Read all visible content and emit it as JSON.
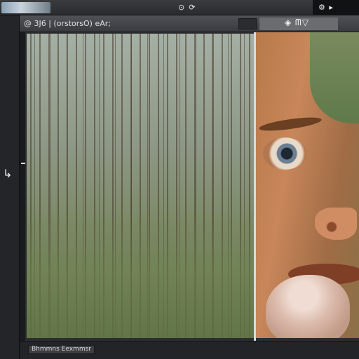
{
  "topbar": {
    "center_icons": [
      "⊙",
      "⟳"
    ],
    "right_label": "⚙ ▸"
  },
  "document": {
    "title": "@ 3J6 | (orstorsO) eAr;",
    "right_label": "◈ ᗰ▽"
  },
  "sidebar": {
    "arrow_glyph": "↳"
  },
  "statusbar": {
    "text": "Bhmmns  Eexmmsr"
  },
  "icons": {
    "topbar": [
      "view-icon",
      "rotate-icon",
      "settings-icon"
    ],
    "sidebar": [
      "arrow-icon"
    ]
  }
}
